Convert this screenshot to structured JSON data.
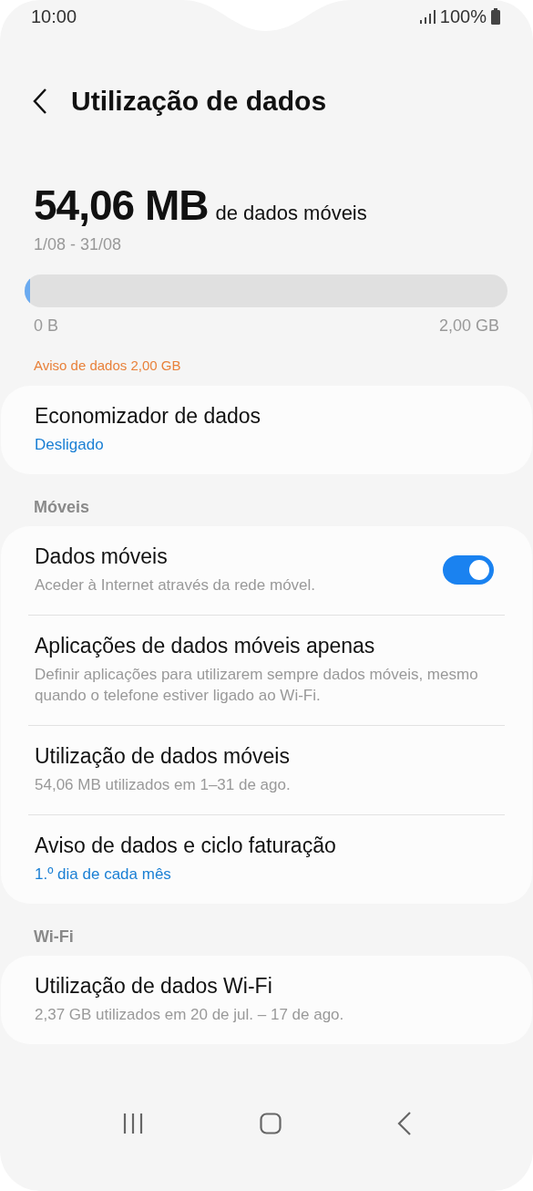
{
  "status_bar": {
    "time": "10:00",
    "battery": "100%"
  },
  "header": {
    "title": "Utilização de dados"
  },
  "usage": {
    "amount": "54,06 MB",
    "amount_label": "de dados móveis",
    "period": "1/08 - 31/08",
    "level": 0.012,
    "min_label": "0 B",
    "max_label": "2,00 GB",
    "warning": "Aviso de dados 2,00 GB"
  },
  "sections": [
    {
      "items": [
        {
          "title": "Economizador de dados",
          "subtitle": "Desligado",
          "kind": "value"
        }
      ]
    },
    {
      "header": "Móveis",
      "items": [
        {
          "title": "Dados móveis",
          "subtitle": "Aceder à Internet através da rede móvel.",
          "kind": "description",
          "switch": {
            "on": true
          }
        },
        {
          "title": "Aplicações de dados móveis apenas",
          "subtitle": "Definir aplicações para utilizarem sempre dados móveis, mesmo quando o telefone estiver ligado ao Wi-Fi.",
          "kind": "description"
        },
        {
          "title": "Utilização de dados móveis",
          "subtitle": "54,06 MB utilizados em 1–31 de ago.",
          "kind": "description"
        },
        {
          "title": "Aviso de dados e ciclo faturação",
          "subtitle": "1.º dia de cada mês",
          "kind": "value"
        }
      ]
    },
    {
      "header": "Wi-Fi",
      "items": [
        {
          "title": "Utilização de dados Wi-Fi",
          "subtitle": "2,37 GB utilizados em 20 de jul. – 17 de ago.",
          "kind": "description"
        }
      ]
    }
  ]
}
